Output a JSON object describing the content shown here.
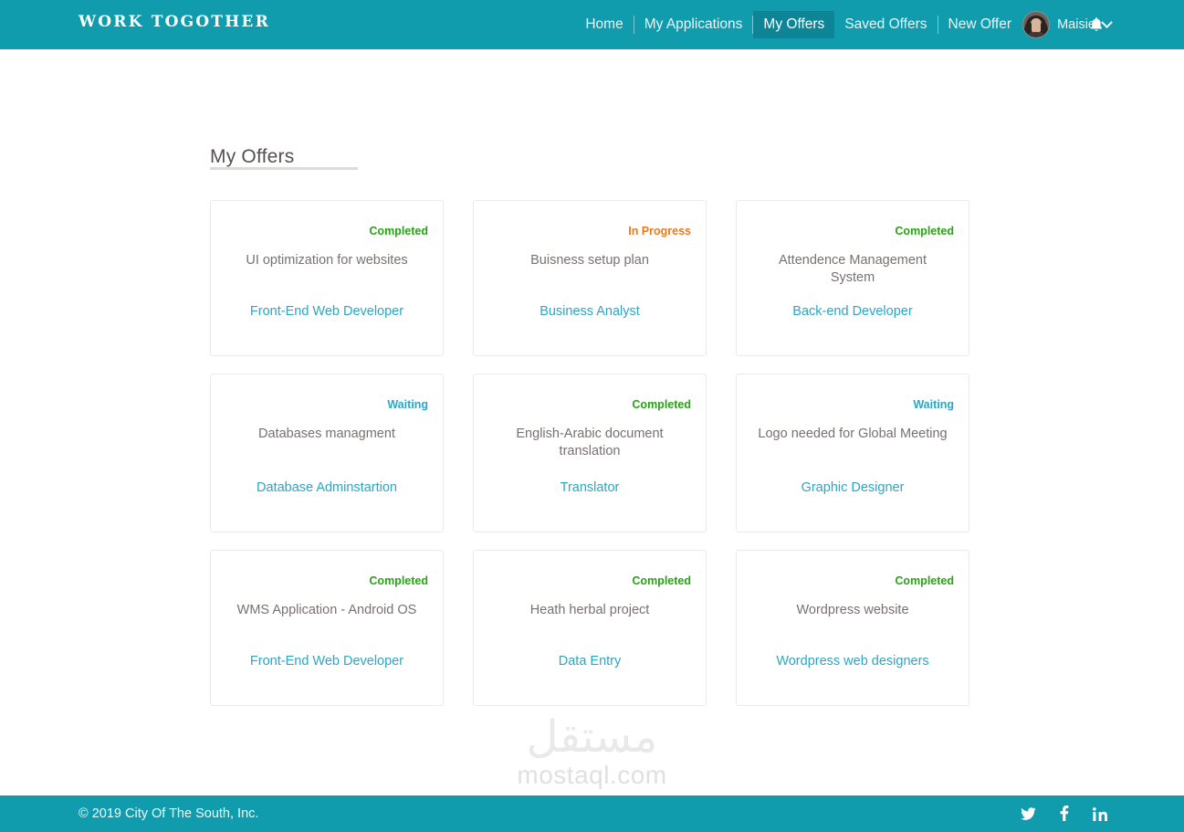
{
  "colors": {
    "brand_teal": "#119CAE",
    "active_nav": "#0E8596",
    "link": "#2AA7C4",
    "status_completed": "#27A413",
    "status_in_progress": "#F07818",
    "status_waiting": "#2AA7C4",
    "card_border": "#eceaea",
    "title_text": "#555150"
  },
  "header": {
    "brand": "WORK TOGOTHER",
    "nav": [
      {
        "label": "Home",
        "active": false
      },
      {
        "label": "My Applications",
        "active": false
      },
      {
        "label": "My Offers",
        "active": true
      },
      {
        "label": "Saved Offers",
        "active": false
      },
      {
        "label": "New Offer",
        "active": false
      }
    ],
    "user": {
      "name": "Maisie",
      "avatar_icon": "user-avatar-photo",
      "chevron_icon": "chevron-down-icon"
    },
    "notifications_icon": "bell-icon"
  },
  "page": {
    "title": "My Offers"
  },
  "offers": [
    {
      "status": "Completed",
      "status_kind": "completed",
      "title": "UI optimization  for websites",
      "role": "Front-End Web Developer"
    },
    {
      "status": "In Progress",
      "status_kind": "inprogress",
      "title": "Buisness setup plan",
      "role": "Business Analyst"
    },
    {
      "status": "Completed",
      "status_kind": "completed",
      "title": "Attendence Management System",
      "role": "Back-end Developer"
    },
    {
      "status": "Waiting",
      "status_kind": "waiting",
      "title": "Databases managment",
      "role": "Database Adminstartion"
    },
    {
      "status": "Completed",
      "status_kind": "completed",
      "title": "English-Arabic document translation",
      "role": "Translator"
    },
    {
      "status": "Waiting",
      "status_kind": "waiting",
      "title": "Logo needed for Global Meeting",
      "role": "Graphic Designer"
    },
    {
      "status": "Completed",
      "status_kind": "completed",
      "title": "WMS Application - Android OS",
      "role": "Front-End Web Developer"
    },
    {
      "status": "Completed",
      "status_kind": "completed",
      "title": "Heath herbal project",
      "role": "Data Entry"
    },
    {
      "status": "Completed",
      "status_kind": "completed",
      "title": "Wordpress website",
      "role": "Wordpress web designers"
    }
  ],
  "watermark": {
    "arabic": "مستقل",
    "latin": "mostaql.com"
  },
  "footer": {
    "copyright": "© 2019 City Of The South, Inc.",
    "socials": [
      {
        "name": "twitter-icon"
      },
      {
        "name": "facebook-icon"
      },
      {
        "name": "linkedin-icon"
      }
    ]
  }
}
